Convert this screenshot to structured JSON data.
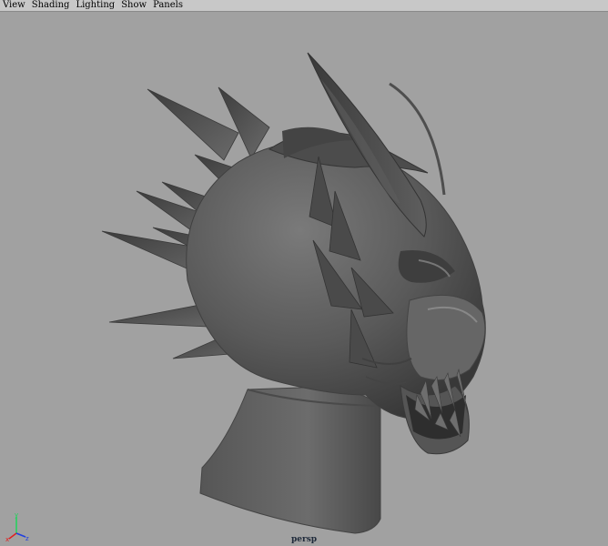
{
  "menubar": {
    "items": [
      {
        "label": "View"
      },
      {
        "label": "Shading"
      },
      {
        "label": "Lighting"
      },
      {
        "label": "Show"
      },
      {
        "label": "Panels"
      }
    ]
  },
  "viewport": {
    "camera_label": "persp",
    "background_color": "#a1a1a1",
    "model_color": "#5a5a5a",
    "axis": {
      "y_label": "y",
      "x_label": "x",
      "z_label": "z",
      "y_color": "#1fd25a",
      "x_color": "#e02020",
      "z_color": "#2040e0"
    }
  }
}
